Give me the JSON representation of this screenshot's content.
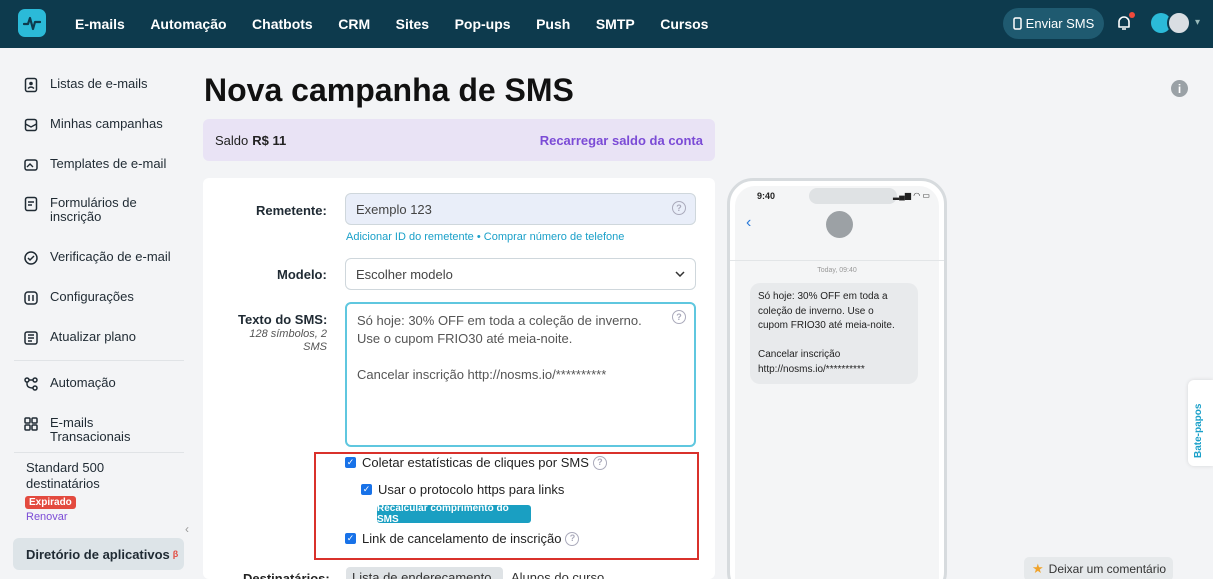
{
  "topbar": {
    "nav": [
      "E-mails",
      "Automação",
      "Chatbots",
      "CRM",
      "Sites",
      "Pop-ups",
      "Push",
      "SMTP",
      "Cursos"
    ],
    "send_sms": "Enviar SMS"
  },
  "sidebar": {
    "items": [
      {
        "label": "Listas de e-mails",
        "icon": "contacts-icon"
      },
      {
        "label": "Minhas campanhas",
        "icon": "campaigns-icon"
      },
      {
        "label": "Templates de e-mail",
        "icon": "templates-icon"
      },
      {
        "label": "Formulários de inscrição",
        "icon": "forms-icon"
      },
      {
        "label": "Verificação de e-mail",
        "icon": "check-circle-icon"
      },
      {
        "label": "Configurações",
        "icon": "settings-icon"
      },
      {
        "label": "Atualizar plano",
        "icon": "upgrade-icon"
      },
      {
        "label": "Automação",
        "icon": "automation-icon"
      },
      {
        "label": "E-mails Transacionais",
        "icon": "transactional-icon"
      }
    ],
    "plan": "Standard 500 destinatários",
    "expired_badge": "Expirado",
    "renew": "Renovar",
    "app_directory": "Diretório de aplicativos",
    "beta_mark": "β"
  },
  "page": {
    "title": "Nova campanha de SMS",
    "balance_label": "Saldo",
    "balance_value": "R$ 11",
    "reload_link": "Recarregar saldo da conta"
  },
  "form": {
    "sender_label": "Remetente:",
    "sender_value": "Exemplo 123",
    "sender_links": "Adicionar ID do remetente • Comprar número de telefone",
    "template_label": "Modelo:",
    "template_value": "Escolher modelo",
    "text_label": "Texto do SMS:",
    "text_info": "128 símbolos, 2 SMS",
    "sms_line1": "Só hoje: 30% OFF em toda a coleção de inverno.",
    "sms_line2": "Use o cupom FRIO30 até meia-noite.",
    "sms_line3": "Cancelar inscrição http://nosms.io/**********",
    "opt_clicks": "Coletar estatísticas de cliques por SMS",
    "opt_https": "Usar o protocolo https para links",
    "recalc_button": "Recalcular comprimento do SMS",
    "opt_unsubscribe": "Link de cancelamento de inscrição",
    "recipients_label": "Destinatários:",
    "recipients_tab1": "Lista de endereçamento",
    "recipients_tab2": "Alunos do curso"
  },
  "phone": {
    "time": "9:40",
    "date": "Today, 09:40",
    "bubble_l1": "Só hoje: 30% OFF em toda a",
    "bubble_l2": "coleção de inverno. Use o",
    "bubble_l3": "cupom FRIO30 até meia-noite.",
    "bubble_l4": "Cancelar inscrição",
    "bubble_l5": "http://nosms.io/**********"
  },
  "chat_tab": "Bate-papos",
  "feedback": "Deixar um comentário",
  "colors": {
    "topbar": "#0d3a4d",
    "accent": "#2bbad8",
    "link_purple": "#7b4bd6",
    "highlight_red": "#d9312b"
  }
}
